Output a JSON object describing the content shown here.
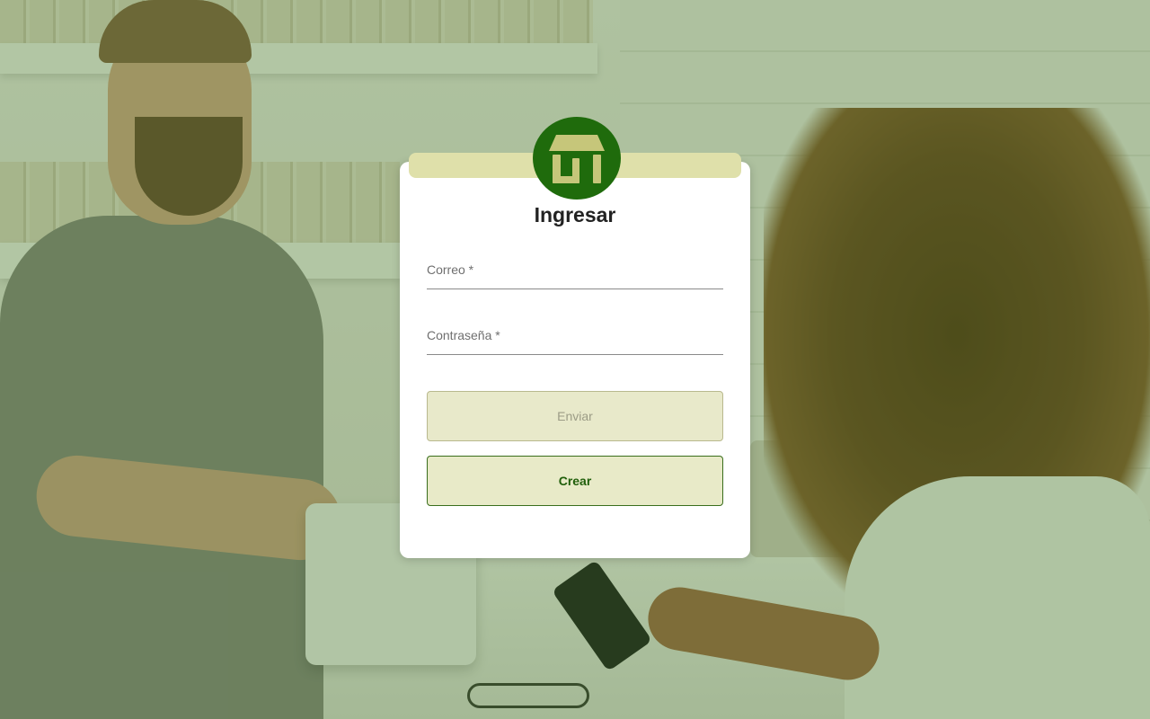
{
  "app": {
    "logo_icon": "storefront-icon",
    "brand_color": "#1f6b0c",
    "accent_color": "#e0e1ab"
  },
  "login": {
    "title": "Ingresar",
    "email_label": "Correo *",
    "email_value": "",
    "password_label": "Contraseña *",
    "password_value": "",
    "submit_label": "Enviar",
    "create_label": "Crear"
  }
}
